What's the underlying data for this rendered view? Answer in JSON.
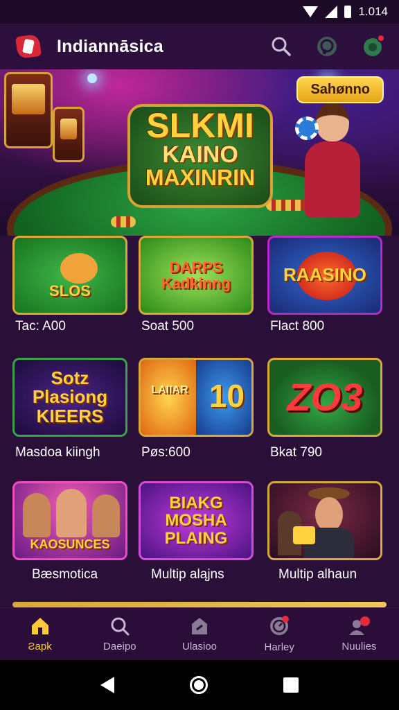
{
  "status_bar": {
    "time": "1.014"
  },
  "header": {
    "app_title": "Indiannāsica",
    "notification_dot_color": "#e62a3a"
  },
  "hero": {
    "logo_line1": "SLKMI",
    "logo_line2": "KAINO",
    "logo_line3": "MAXINRIN",
    "pill_label": "Sahønno"
  },
  "games": [
    {
      "title": "SLOS",
      "label": "Tac: A00"
    },
    {
      "title": "DARPS Kadkinng",
      "label": "Soat 500"
    },
    {
      "title": "RAASINO",
      "label": "Flact 800"
    },
    {
      "title": "Sotz Plasiong KIEERS",
      "label": "Masdoa kiingh"
    },
    {
      "title": "LAIIAR",
      "title_b": "10",
      "label": "Pøs:600"
    },
    {
      "title": "ZO3",
      "label": "Bkat 790"
    },
    {
      "title": "KAOSUNCES",
      "label": "Bæsmotica"
    },
    {
      "title": "BIAKG MOSHA PLAING",
      "label": "Multip aląjns"
    },
    {
      "title": "",
      "label": "Multip alhaun"
    }
  ],
  "bottom_nav": [
    {
      "label": "Ƨapk",
      "icon": "home-icon"
    },
    {
      "label": "Daeipo",
      "icon": "search-icon"
    },
    {
      "label": "Ulasioo",
      "icon": "tag-icon"
    },
    {
      "label": "Harley",
      "icon": "clock-icon"
    },
    {
      "label": "Nuulies",
      "icon": "users-icon"
    }
  ],
  "colors": {
    "accent": "#ffc93a",
    "background": "#2a0f38",
    "card_border": "#d8a83a"
  }
}
